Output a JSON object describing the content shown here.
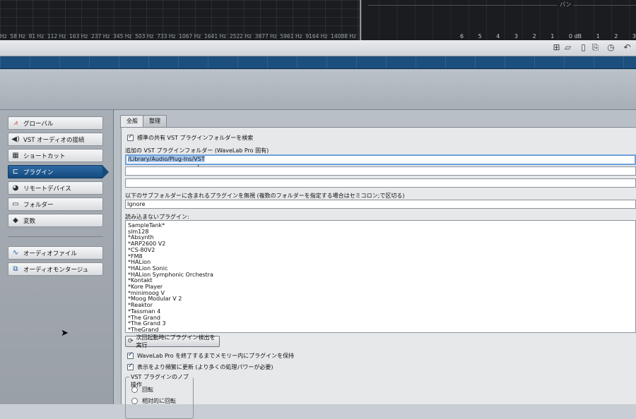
{
  "spectrum": {
    "freq_labels": [
      "Hz",
      "58 Hz",
      "81 Hz",
      "112 Hz",
      "163 Hz",
      "237 Hz",
      "345 Hz",
      "503 Hz",
      "733 Hz",
      "1067 Hz",
      "1641 Hz",
      "2522 Hz",
      "3877 Hz",
      "5961 Hz",
      "9164 Hz",
      "14088 Hz"
    ]
  },
  "pan": {
    "title": "パン",
    "db_scale": [
      "6",
      "5",
      "4",
      "3",
      "2",
      "1",
      "0 dB",
      "1",
      "2",
      "3"
    ]
  },
  "toolbar": {
    "icons": [
      "add-item-icon",
      "open-folder-icon",
      "clipboard-icon",
      "export-icon",
      "history-icon",
      "undo-icon"
    ]
  },
  "sidebar": {
    "items": [
      {
        "label": "グローバル",
        "icon": "global-icon"
      },
      {
        "label": "VST オーディオの接続",
        "icon": "speaker-icon"
      },
      {
        "label": "ショートカット",
        "icon": "keyboard-icon"
      },
      {
        "label": "プラグイン",
        "icon": "plugin-icon",
        "active": true
      },
      {
        "label": "リモートデバイス",
        "icon": "remote-icon"
      },
      {
        "label": "フォルダー",
        "icon": "folder-icon"
      },
      {
        "label": "変数",
        "icon": "tag-icon"
      }
    ],
    "items2": [
      {
        "label": "オーディオファイル",
        "icon": "waveform-icon"
      },
      {
        "label": "オーディオモンタージュ",
        "icon": "montage-icon"
      }
    ]
  },
  "tabs": [
    {
      "label": "全般",
      "active": true
    },
    {
      "label": "整理",
      "active": false
    }
  ],
  "general": {
    "search_shared_label": "標準の共有 VST プラグインフォルダーを検索",
    "extra_folders_label": "追加の VST プラグインフォルダー (WaveLab Pro 固有)",
    "folder1": "/Library/Audio/Plug-Ins/VST",
    "folder2": "",
    "folder3": "",
    "ignore_label": "以下のサブフォルダーに含まれるプラグインを無視 (複数のフォルダーを指定する場合はセミコロン;で区切る)",
    "ignore_value": "Ignore",
    "not_loaded_label": "読み込まないプラグイン:",
    "not_loaded_list": [
      "SampleTank*",
      "slm128",
      "*Absynth",
      "*ARP2600 V2",
      "*CS-80V2",
      "*FM8",
      "*HALion",
      "*HALion Sonic",
      "*HALion Symphonic Orchestra",
      "*Kontakt",
      "*Kore Player",
      "*minimoog V",
      "*Moog Modular V 2",
      "*Reaktor",
      "*Tassman 4",
      "*The Grand",
      "*The Grand 3",
      "*TheGrand"
    ],
    "rescan_button": "次回起動時にプラグイン検出を実行",
    "keep_in_memory_label": "WaveLab Pro を終了するまでメモリー内にプラグインを保持",
    "refresh_label": "表示をより頻繁に更新 (より多くの処理パワーが必要)",
    "knob_group_label": "VST プラグインのノブ操作",
    "knob_options": [
      "回転",
      "相対的に回転"
    ]
  }
}
